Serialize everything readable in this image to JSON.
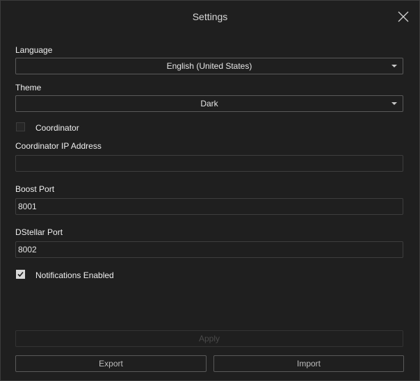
{
  "window": {
    "title": "Settings",
    "close_icon": "close-icon"
  },
  "language": {
    "label": "Language",
    "selected": "English (United States)"
  },
  "theme": {
    "label": "Theme",
    "selected": "Dark"
  },
  "coordinator": {
    "label": "Coordinator",
    "checked": false
  },
  "coordinator_ip": {
    "label": "Coordinator IP Address",
    "value": ""
  },
  "boost_port": {
    "label": "Boost Port",
    "value": "8001"
  },
  "dstellar_port": {
    "label": "DStellar Port",
    "value": "8002"
  },
  "notifications": {
    "label": "Notifications Enabled",
    "checked": true
  },
  "actions": {
    "apply_label": "Apply",
    "export_label": "Export",
    "import_label": "Import"
  },
  "colors": {
    "background": "#1f1f1f",
    "border": "#5a5a5a",
    "text": "#e6e6e6",
    "disabled_text": "#4a4a4a"
  }
}
